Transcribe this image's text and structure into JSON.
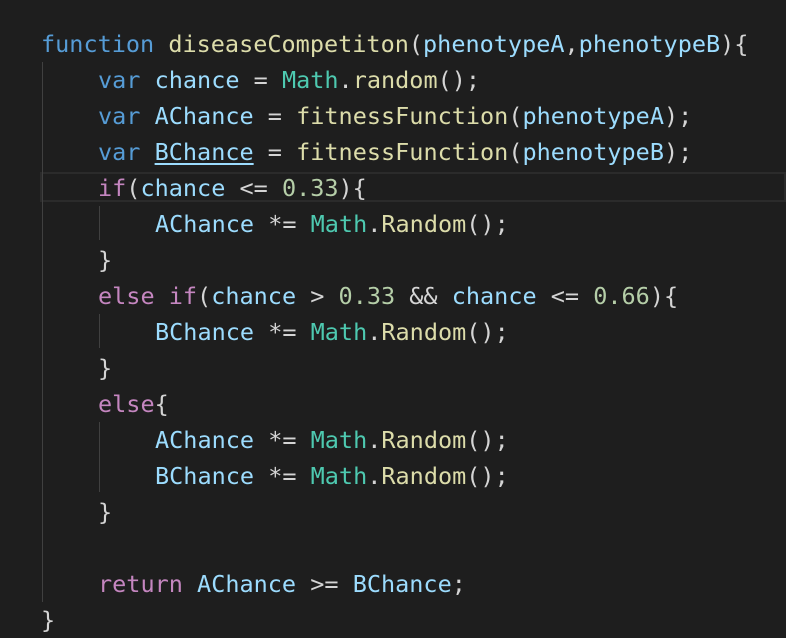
{
  "colors": {
    "background": "#1e1e1e",
    "keyword": "#569cd6",
    "control": "#c586c0",
    "function": "#dcdcaa",
    "variable": "#9cdcfe",
    "class": "#4ec9b0",
    "number": "#b5cea8",
    "punctuation": "#d4d4d4"
  },
  "code": {
    "l1": {
      "kw": "function",
      "name": "diseaseCompetiton",
      "p1": "(",
      "a1": "phenotypeA",
      "p2": ",",
      "a2": "phenotypeB",
      "p3": "){"
    },
    "l2": {
      "kw": "var",
      "name": "chance",
      "op": " = ",
      "cls": "Math",
      "dot": ".",
      "fn": "random",
      "end": "();"
    },
    "l3": {
      "kw": "var",
      "name": "AChance",
      "op": " = ",
      "fn": "fitnessFunction",
      "p1": "(",
      "arg": "phenotypeA",
      "end": ");"
    },
    "l4": {
      "kw": "var",
      "name": "BChance",
      "op": " = ",
      "fn": "fitnessFunction",
      "p1": "(",
      "arg": "phenotypeB",
      "end": ");"
    },
    "l5": {
      "ctrl": "if",
      "p1": "(",
      "v": "chance",
      "op": " <= ",
      "num": "0.33",
      "end": "){"
    },
    "l6": {
      "v": "AChance",
      "op": " *= ",
      "cls": "Math",
      "dot": ".",
      "fn": "Random",
      "end": "();"
    },
    "l7": {
      "end": "}"
    },
    "l8": {
      "ctrl1": "else",
      "sp": " ",
      "ctrl2": "if",
      "p1": "(",
      "v1": "chance",
      "op1": " > ",
      "num1": "0.33",
      "op2": " && ",
      "v2": "chance",
      "op3": " <= ",
      "num2": "0.66",
      "end": "){"
    },
    "l9": {
      "v": "BChance",
      "op": " *= ",
      "cls": "Math",
      "dot": ".",
      "fn": "Random",
      "end": "();"
    },
    "l10": {
      "end": "}"
    },
    "l11": {
      "ctrl": "else",
      "end": "{"
    },
    "l12": {
      "v": "AChance",
      "op": " *= ",
      "cls": "Math",
      "dot": ".",
      "fn": "Random",
      "end": "();"
    },
    "l13": {
      "v": "BChance",
      "op": " *= ",
      "cls": "Math",
      "dot": ".",
      "fn": "Random",
      "end": "();"
    },
    "l14": {
      "end": "}"
    },
    "l16": {
      "ctrl": "return",
      "v1": "AChance",
      "op": " >= ",
      "v2": "BChance",
      "end": ";"
    },
    "l17": {
      "end": "}"
    }
  }
}
